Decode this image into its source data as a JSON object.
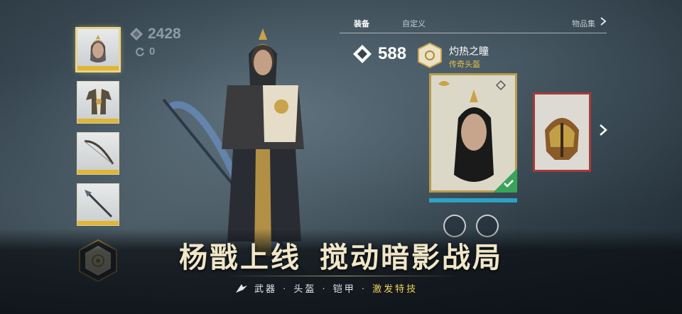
{
  "stats": {
    "power": "2428",
    "refresh_count": "0"
  },
  "tabs": {
    "equip": "装备",
    "customize": "自定义",
    "collection": "物品集"
  },
  "item": {
    "score": "588",
    "name": "灼热之瞳",
    "type": "传奇头盔"
  },
  "banner": {
    "headline_part1": "杨戬上线",
    "headline_part2": "搅动暗影战局",
    "sub_items": [
      "武器",
      "·",
      "头盔",
      "·",
      "铠甲",
      "·"
    ],
    "sub_highlight": "激发特技"
  },
  "colors": {
    "accent_gold": "#e0b632",
    "legendary": "#e7c149",
    "equipped_green": "#3aa35a",
    "progress_cyan": "#28b3d6"
  },
  "icons": [
    "gem-icon",
    "refresh-icon",
    "chevron-right-icon",
    "check-icon",
    "badge-icon",
    "emblem-icon"
  ]
}
